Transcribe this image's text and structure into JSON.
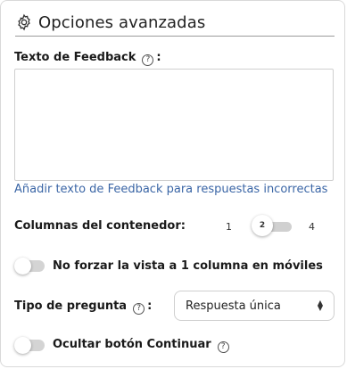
{
  "header": {
    "title": "Opciones avanzadas",
    "icon": "gear-icon"
  },
  "feedback": {
    "label": "Texto de Feedback",
    "colon": ":",
    "value": "",
    "link": "Añadir texto de Feedback para respuestas incorrectas"
  },
  "columns": {
    "label": "Columnas del contenedor:",
    "min": "1",
    "current": "2",
    "max": "4",
    "value": 2
  },
  "mobile_toggle": {
    "label": "No forzar la vista a 1 columna en móviles",
    "checked": false
  },
  "question_type": {
    "label": "Tipo de pregunta",
    "colon": ":",
    "selected": "Respuesta única"
  },
  "continue_toggle": {
    "label": "Ocultar botón Continuar",
    "checked": false
  },
  "help_icon_text": "?",
  "colors": {
    "link": "#3b66a6",
    "accent": "#2c4fbf",
    "toggle_off": "#d4d4d4"
  }
}
